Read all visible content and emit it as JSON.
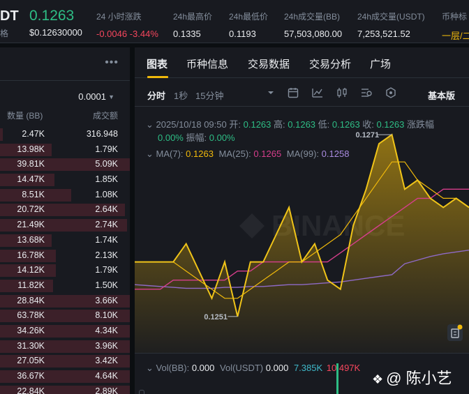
{
  "header": {
    "pair": "DT",
    "pair_sub": "格",
    "last_price": "0.1263",
    "last_price_usd": "$0.12630000",
    "stats": [
      {
        "label": "24 小时涨跌",
        "value": "-0.0046 -3.44%"
      },
      {
        "label": "24h最高价",
        "value": "0.1335"
      },
      {
        "label": "24h最低价",
        "value": "0.1193"
      },
      {
        "label": "24h成交量(BB)",
        "value": "57,503,080.00"
      },
      {
        "label": "24h成交量(USDT)",
        "value": "7,253,521.52"
      },
      {
        "label": "币种标",
        "value": "一层/二"
      }
    ]
  },
  "order_book": {
    "more_icon": "more-dots-icon",
    "tick_size": "0.0001",
    "col_qty": "数量 (BB)",
    "col_total": "成交额",
    "rows": [
      {
        "qty": "2.47K",
        "total": "316.948",
        "depth": 0.02
      },
      {
        "qty": "13.98K",
        "total": "1.79K",
        "depth": 0.4
      },
      {
        "qty": "39.81K",
        "total": "5.09K",
        "depth": 1.0
      },
      {
        "qty": "14.47K",
        "total": "1.85K",
        "depth": 0.42
      },
      {
        "qty": "8.51K",
        "total": "1.08K",
        "depth": 0.55
      },
      {
        "qty": "20.72K",
        "total": "2.64K",
        "depth": 0.96
      },
      {
        "qty": "21.49K",
        "total": "2.74K",
        "depth": 0.98
      },
      {
        "qty": "13.68K",
        "total": "1.74K",
        "depth": 0.4
      },
      {
        "qty": "16.78K",
        "total": "2.13K",
        "depth": 0.43
      },
      {
        "qty": "14.12K",
        "total": "1.79K",
        "depth": 0.43
      },
      {
        "qty": "11.82K",
        "total": "1.50K",
        "depth": 0.41
      },
      {
        "qty": "28.84K",
        "total": "3.66K",
        "depth": 1.0
      },
      {
        "qty": "63.78K",
        "total": "8.10K",
        "depth": 1.0
      },
      {
        "qty": "34.26K",
        "total": "4.34K",
        "depth": 1.0
      },
      {
        "qty": "31.30K",
        "total": "3.96K",
        "depth": 1.0
      },
      {
        "qty": "27.05K",
        "total": "3.42K",
        "depth": 1.0
      },
      {
        "qty": "36.67K",
        "total": "4.64K",
        "depth": 1.0
      },
      {
        "qty": "22.84K",
        "total": "2.89K",
        "depth": 1.0
      }
    ]
  },
  "tabs": [
    {
      "label": "图表",
      "active": true
    },
    {
      "label": "币种信息",
      "active": false
    },
    {
      "label": "交易数据",
      "active": false
    },
    {
      "label": "交易分析",
      "active": false
    },
    {
      "label": "广场",
      "active": false
    }
  ],
  "toolbar": {
    "intervals": [
      "分时",
      "1秒",
      "15分钟"
    ],
    "icons": [
      "interval-dropdown-icon",
      "calendar-icon",
      "indicator-chart-icon",
      "candle-style-icon",
      "settings-icon",
      "hexagon-icon"
    ],
    "view_mode": "基本版"
  },
  "ohlc": {
    "date": "2025/10/18 09:50",
    "open_label": "开:",
    "open": "0.1263",
    "high_label": "高:",
    "high": "0.1263",
    "low_label": "低:",
    "low": "0.1263",
    "close_label": "收:",
    "close": "0.1263",
    "change_label": "涨跌幅",
    "change": "0.00%",
    "amplitude_label": "振幅:",
    "amplitude": "0.00%"
  },
  "ma": [
    {
      "label": "MA(7):",
      "value": "0.1263",
      "color": "#f0b90b"
    },
    {
      "label": "MA(25):",
      "value": "0.1265",
      "color": "#d63e8c"
    },
    {
      "label": "MA(99):",
      "value": "0.1258",
      "color": "#8e6ac6"
    }
  ],
  "volume": {
    "vol_bb_label": "Vol(BB):",
    "vol_bb": "0.000",
    "vol_usdt_label": "Vol(USDT)",
    "vol_usdt": "0.000",
    "vol_ma1": "7.385K",
    "vol_ma2": "10.497K"
  },
  "watermark": {
    "text": "@ 陈小艺"
  },
  "colors": {
    "up": "#2ebd85",
    "down": "#f6465d",
    "accent": "#f0b90b",
    "bg": "#0b0e11",
    "panel": "#181a20"
  },
  "chart_data": {
    "type": "area",
    "series": [
      {
        "name": "MA(7)",
        "values": [
          0.1257,
          0.1257,
          0.1257,
          0.1257,
          0.1256,
          0.1255,
          0.1254,
          0.1253,
          0.1253,
          0.1254,
          0.1255,
          0.1256,
          0.1257,
          0.1257,
          0.1258,
          0.1259,
          0.126,
          0.1262,
          0.1264,
          0.1266,
          0.1268,
          0.1268,
          0.1266,
          0.1265,
          0.1264,
          0.1264,
          0.1263
        ]
      },
      {
        "name": "MA(25)",
        "values": [
          0.1254,
          0.1254,
          0.1254,
          0.1255,
          0.1255,
          0.1255,
          0.1255,
          0.1255,
          0.1256,
          0.1256,
          0.1257,
          0.1257,
          0.1257,
          0.1257,
          0.1257,
          0.1257,
          0.1258,
          0.1259,
          0.126,
          0.1261,
          0.1262,
          0.1263,
          0.1264,
          0.1264,
          0.1265,
          0.1265,
          0.1265
        ]
      },
      {
        "name": "MA(99)",
        "values": [
          0.12545,
          0.12544,
          0.12543,
          0.12542,
          0.12541,
          0.12541,
          0.12541,
          0.12542,
          0.12542,
          0.12543,
          0.12543,
          0.12544,
          0.12545,
          0.12545,
          0.12546,
          0.12547,
          0.12548,
          0.1255,
          0.12552,
          0.12554,
          0.12556,
          0.12568,
          0.12572,
          0.12576,
          0.12579,
          0.12581,
          0.12583
        ]
      }
    ],
    "price_values": [
      0.1257,
      0.1257,
      0.1257,
      0.1257,
      0.1259,
      0.1256,
      0.1253,
      0.1257,
      0.1251,
      0.1257,
      0.1257,
      0.126,
      0.1263,
      0.1257,
      0.1259,
      0.1255,
      0.1254,
      0.1261,
      0.1265,
      0.127,
      0.1271,
      0.1265,
      0.1266,
      0.1264,
      0.1263,
      0.1264,
      0.1263
    ],
    "high_label": "0.1271",
    "low_label": "0.1251",
    "ylim": [
      0.1247,
      0.1274
    ]
  }
}
